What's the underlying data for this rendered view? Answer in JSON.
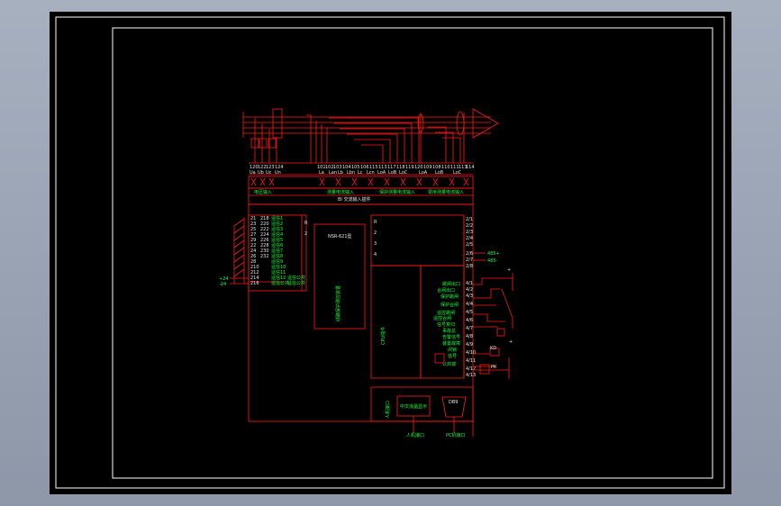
{
  "terminals_top": {
    "numbers": [
      "120",
      "122",
      "123",
      "124",
      "101",
      "102",
      "103",
      "104",
      "105",
      "106",
      "115",
      "113",
      "117",
      "118",
      "119",
      "120",
      "109",
      "108",
      "110",
      "111",
      "113",
      "114",
      "112"
    ],
    "sublabels": [
      "Ua",
      "Ub",
      "Uc",
      "Un",
      "La",
      "Lan",
      "Lb",
      "Lbn",
      "Lc",
      "Lcn",
      "LoA",
      "LoB",
      "LoC",
      "LoA",
      "LoB",
      "LoC"
    ]
  },
  "headers": {
    "voltage": "电压输入",
    "current1": "测量电流输入",
    "current2": "保护测量电流输入",
    "current3": "零序测量电流输入",
    "bus": "BI   交流输入插件"
  },
  "left_terminals": {
    "numbers": [
      "21",
      "23",
      "25",
      "27",
      "29",
      "22",
      "24",
      "26",
      "28",
      "210",
      "212",
      "214",
      "216",
      "218",
      "220",
      "222",
      "224",
      "226",
      "228",
      "230",
      "232"
    ],
    "signals": [
      "遥信1",
      "遥信2",
      "遥信3",
      "遥信4",
      "遥信5",
      "遥信6",
      "遥信7",
      "遥信8",
      "遥信9",
      "遥信10",
      "遥信11",
      "遥信12",
      "遥信公共",
      "遥信公共",
      "遥信公共"
    ],
    "plus_label": "+24",
    "minus_label": "-24"
  },
  "module": {
    "title": "NSR-621型",
    "subtitle": "线路保护测控装置"
  },
  "cpu": {
    "label": "CPU插件",
    "letters": [
      "R",
      "2",
      "3",
      "4"
    ]
  },
  "right_terminals": {
    "numbers": [
      "2/1",
      "2/2",
      "2/3",
      "2/4",
      "2/5",
      "2/6",
      "2/7",
      "2/8",
      "4/1",
      "4/2",
      "4/3",
      "4/4",
      "4/5",
      "4/6",
      "4/7",
      "4/8",
      "4/9",
      "4/10",
      "4/11",
      "4/12",
      "4/13"
    ],
    "outputs": [
      "跳闸出口",
      "合闸出口",
      "保护跳闸",
      "保护合闸",
      "遥控跳闸",
      "遥控合闸",
      "信号复归",
      "事故总",
      "告警信号",
      "装置故障",
      "闭锁",
      "信号",
      "公共端"
    ],
    "net_a": "485+",
    "net_b": "485-"
  },
  "bottom": {
    "display_label": "中文液晶显示",
    "panel_label": "人机接口",
    "port_label": "DB9",
    "port_caption": "PC机接口",
    "side_label": "人机接口"
  },
  "misc": {
    "plus": "+",
    "kd": "KD",
    "pk": "PK"
  }
}
